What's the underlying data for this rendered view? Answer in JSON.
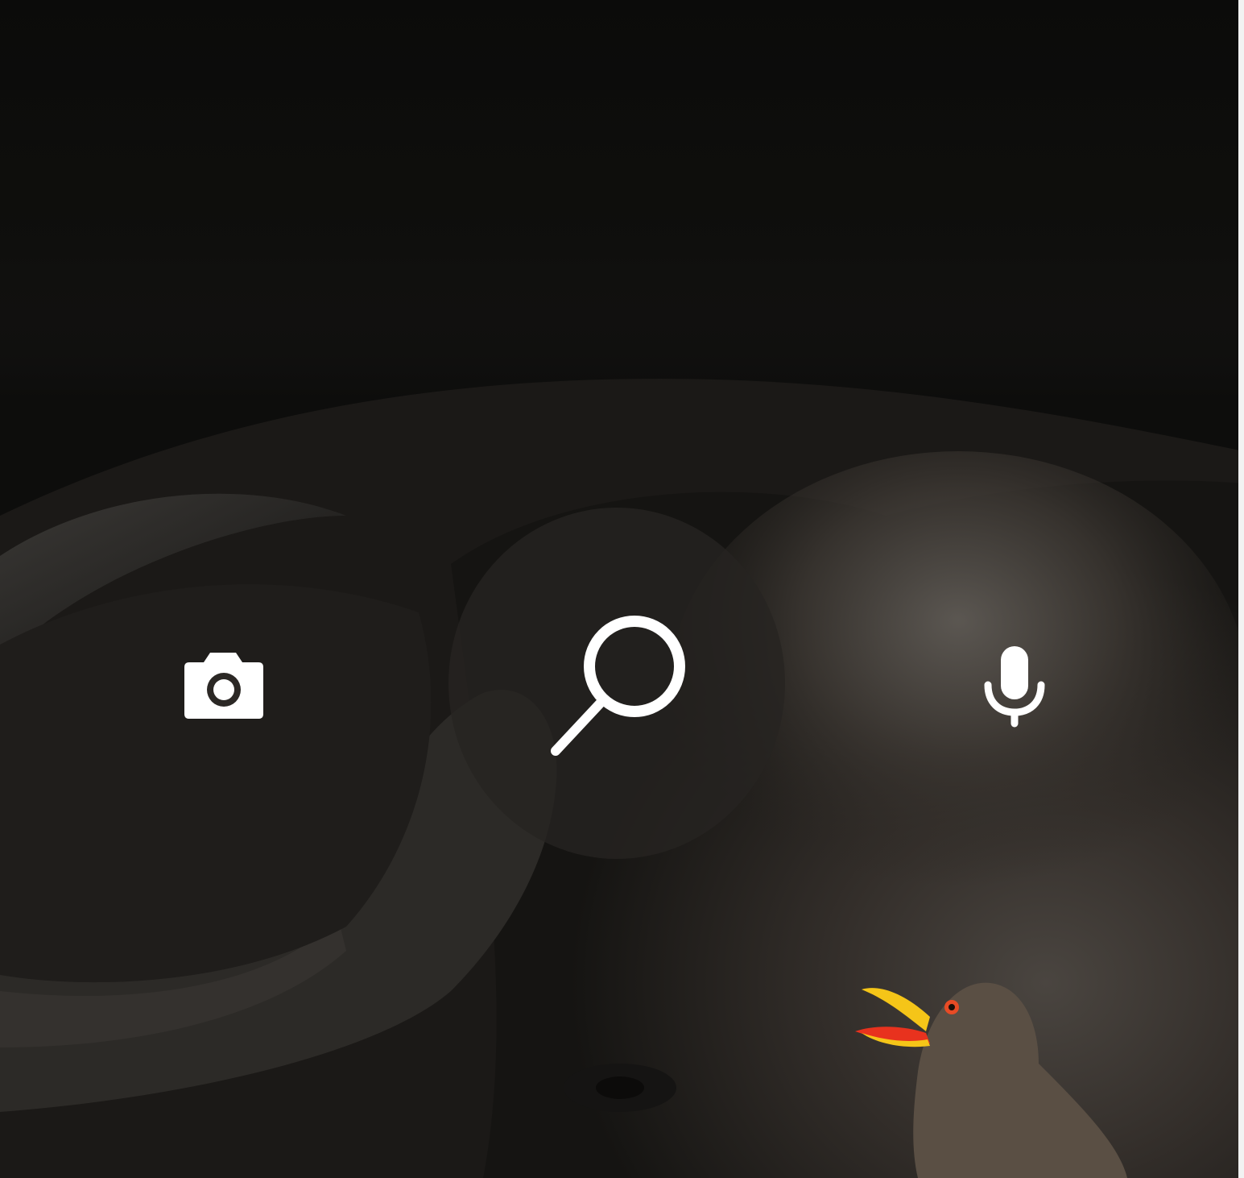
{
  "wallpaper": {
    "subject_icon": "buffalo-with-oxpecker-photo",
    "colors": {
      "dark": "#0c0c0b",
      "fur": "#3a342e",
      "beak_yellow": "#f5c518",
      "beak_red": "#e8321e"
    }
  },
  "actions": {
    "camera": {
      "icon": "camera-icon"
    },
    "search": {
      "icon": "search-icon"
    },
    "voice": {
      "icon": "microphone-icon"
    }
  },
  "colors": {
    "icon": "#ffffff",
    "circle": "rgba(38,36,33,0.78)"
  }
}
